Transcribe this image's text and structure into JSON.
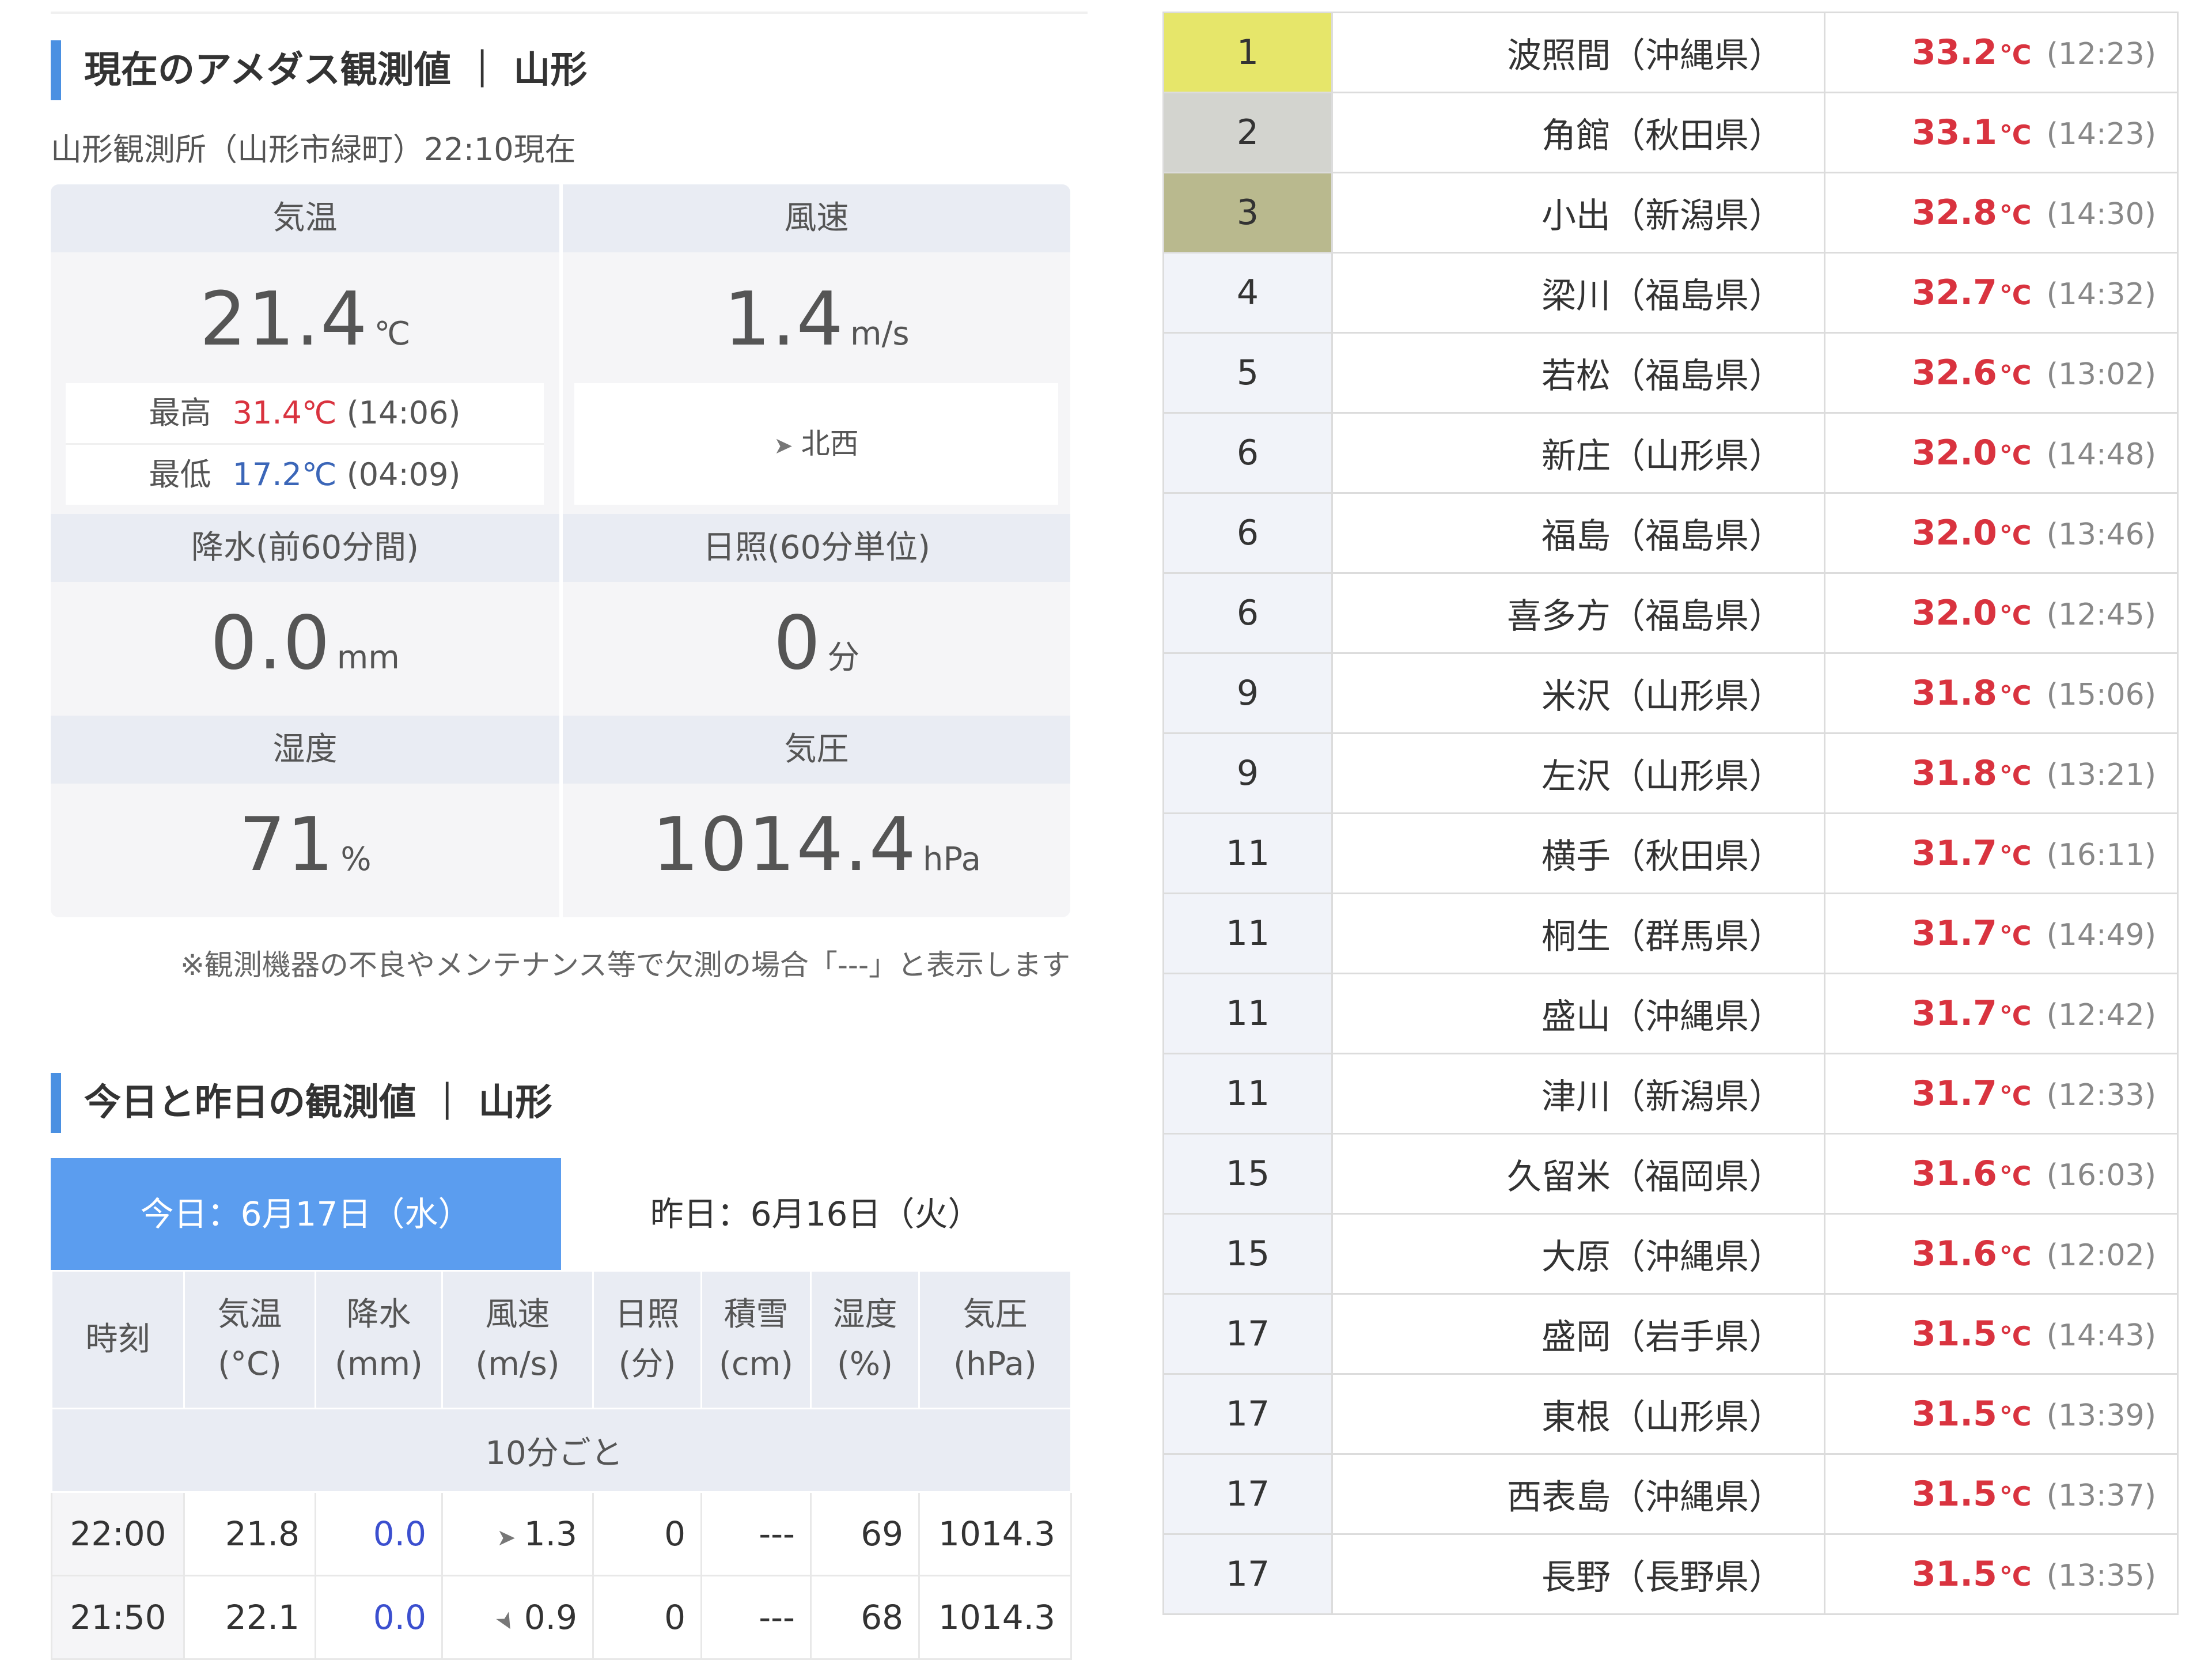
{
  "current": {
    "title": "現在のアメダス観測値 ｜ 山形",
    "station": "山形観測所（山形市緑町）22:10現在",
    "temp": {
      "label": "気温",
      "value": "21.4",
      "unit": "℃"
    },
    "high": {
      "label": "最高",
      "value": "31.4℃",
      "time": "(14:06)"
    },
    "low": {
      "label": "最低",
      "value": "17.2℃",
      "time": "(04:09)"
    },
    "wind": {
      "label": "風速",
      "value": "1.4",
      "unit": "m/s",
      "direction": "北西"
    },
    "precip": {
      "label": "降水(前60分間)",
      "value": "0.0",
      "unit": "mm"
    },
    "sun": {
      "label": "日照(60分単位)",
      "value": "0",
      "unit": "分"
    },
    "humidity": {
      "label": "湿度",
      "value": "71",
      "unit": "%"
    },
    "pressure": {
      "label": "気圧",
      "value": "1014.4",
      "unit": "hPa"
    },
    "note": "※観測機器の不良やメンテナンス等で欠測の場合「---」と表示します"
  },
  "history": {
    "title": "今日と昨日の観測値 ｜ 山形",
    "tab_today": "今日：6月17日（水）",
    "tab_yesterday": "昨日：6月16日（火）",
    "headers": [
      {
        "l1": "時刻",
        "l2": ""
      },
      {
        "l1": "気温",
        "l2": "(°C)"
      },
      {
        "l1": "降水",
        "l2": "(mm)"
      },
      {
        "l1": "風速",
        "l2": "(m/s)"
      },
      {
        "l1": "日照",
        "l2": "(分)"
      },
      {
        "l1": "積雪",
        "l2": "(cm)"
      },
      {
        "l1": "湿度",
        "l2": "(%)"
      },
      {
        "l1": "気圧",
        "l2": "(hPa)"
      }
    ],
    "interval_label": "10分ごと",
    "rows": [
      {
        "time": "22:00",
        "temp": "21.8",
        "precip": "0.0",
        "wind": "1.3",
        "sun": "0",
        "snow": "---",
        "humidity": "69",
        "pressure": "1014.3"
      },
      {
        "time": "21:50",
        "temp": "22.1",
        "precip": "0.0",
        "wind": "0.9",
        "sun": "0",
        "snow": "---",
        "humidity": "68",
        "pressure": "1014.3"
      }
    ]
  },
  "ranking": [
    {
      "rank": "1",
      "name": "波照間（沖縄県）",
      "temp": "33.2",
      "unit": "℃",
      "time": "(12:23)",
      "color": "#e6e66a"
    },
    {
      "rank": "2",
      "name": "角館（秋田県）",
      "temp": "33.1",
      "unit": "℃",
      "time": "(14:23)",
      "color": "#d3d4cf"
    },
    {
      "rank": "3",
      "name": "小出（新潟県）",
      "temp": "32.8",
      "unit": "℃",
      "time": "(14:30)",
      "color": "#b9b98e"
    },
    {
      "rank": "4",
      "name": "梁川（福島県）",
      "temp": "32.7",
      "unit": "℃",
      "time": "(14:32)"
    },
    {
      "rank": "5",
      "name": "若松（福島県）",
      "temp": "32.6",
      "unit": "℃",
      "time": "(13:02)"
    },
    {
      "rank": "6",
      "name": "新庄（山形県）",
      "temp": "32.0",
      "unit": "℃",
      "time": "(14:48)"
    },
    {
      "rank": "6",
      "name": "福島（福島県）",
      "temp": "32.0",
      "unit": "℃",
      "time": "(13:46)"
    },
    {
      "rank": "6",
      "name": "喜多方（福島県）",
      "temp": "32.0",
      "unit": "℃",
      "time": "(12:45)"
    },
    {
      "rank": "9",
      "name": "米沢（山形県）",
      "temp": "31.8",
      "unit": "℃",
      "time": "(15:06)"
    },
    {
      "rank": "9",
      "name": "左沢（山形県）",
      "temp": "31.8",
      "unit": "℃",
      "time": "(13:21)"
    },
    {
      "rank": "11",
      "name": "横手（秋田県）",
      "temp": "31.7",
      "unit": "℃",
      "time": "(16:11)"
    },
    {
      "rank": "11",
      "name": "桐生（群馬県）",
      "temp": "31.7",
      "unit": "℃",
      "time": "(14:49)"
    },
    {
      "rank": "11",
      "name": "盛山（沖縄県）",
      "temp": "31.7",
      "unit": "℃",
      "time": "(12:42)"
    },
    {
      "rank": "11",
      "name": "津川（新潟県）",
      "temp": "31.7",
      "unit": "℃",
      "time": "(12:33)"
    },
    {
      "rank": "15",
      "name": "久留米（福岡県）",
      "temp": "31.6",
      "unit": "℃",
      "time": "(16:03)"
    },
    {
      "rank": "15",
      "name": "大原（沖縄県）",
      "temp": "31.6",
      "unit": "℃",
      "time": "(12:02)"
    },
    {
      "rank": "17",
      "name": "盛岡（岩手県）",
      "temp": "31.5",
      "unit": "℃",
      "time": "(14:43)"
    },
    {
      "rank": "17",
      "name": "東根（山形県）",
      "temp": "31.5",
      "unit": "℃",
      "time": "(13:39)"
    },
    {
      "rank": "17",
      "name": "西表島（沖縄県）",
      "temp": "31.5",
      "unit": "℃",
      "time": "(13:37)"
    },
    {
      "rank": "17",
      "name": "長野（長野県）",
      "temp": "31.5",
      "unit": "℃",
      "time": "(13:35)"
    }
  ]
}
